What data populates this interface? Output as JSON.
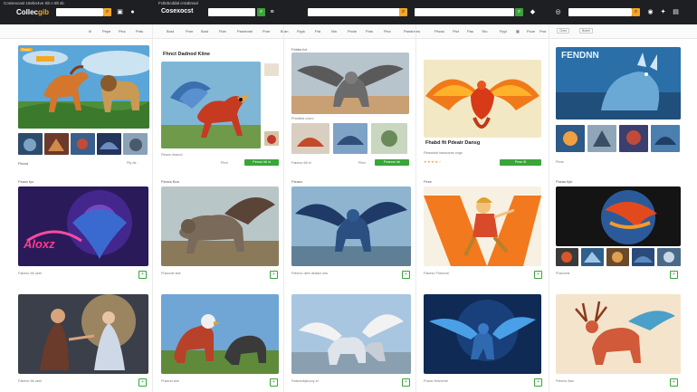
{
  "topbar": {
    "logo_a": "Collec",
    "logo_b": "gib",
    "logo2": "Cosexocst",
    "menu_text": "Cossexcast 16ebn4ve Sb n 5lt sb",
    "menu_text2": "Fctlebcddal cr4abnsal",
    "searches": [
      "",
      "",
      "",
      "",
      ""
    ]
  },
  "categories": [
    "Iii",
    "Pepe",
    "Pinc",
    "Pnts",
    "Bost",
    "Pom",
    "Bost",
    "Fldn",
    "Pandnnel",
    "Pom",
    "Bran",
    "Ppyk",
    "Pat",
    "Nin",
    "Pnvle",
    "Pots",
    "Pntc",
    "Pinc",
    "Pandnnes",
    "Pbcss",
    "Ptct",
    "Pas",
    "Yiio",
    "Ppyl",
    "Pcoe",
    "Prut",
    "Ari"
  ],
  "right_tabs": [
    "Cbed",
    "Bobel"
  ],
  "row1": {
    "c1": {
      "badge": "Feaxc",
      "label": "Pbcsd",
      "small": "Ply de"
    },
    "c2": {
      "title": "Fhnct Dadnod Kiine",
      "small": "Fieaxc eiacnd",
      "button": "Pesnn ldl ni",
      "pill": "Pbnl"
    },
    "c3": {
      "badge": "Febbs fot",
      "small": "Fhxaibst cosrc",
      "button": "Pesnne ldr",
      "meta": "Fabexc 66 el",
      "pill": "Pbnl"
    },
    "c4": {
      "title": "Fhabd fit Pdeatr Dansg",
      "small": "Fleaxsdst tseaocrss cogs",
      "button": "Pesn fil"
    },
    "c5": {
      "title": "FENDNN",
      "small": "Pbns"
    }
  },
  "row2": {
    "c1": {
      "label": "Feaxc tyo",
      "art_text": "Aloxz",
      "caption": "Fabexc 66 ueel"
    },
    "c2": {
      "label": "Fleaxs Boo",
      "caption": "Fhaxcde sbe"
    },
    "c3": {
      "label": "Fteanc",
      "caption": "Febexx dieh dedaxl ues"
    },
    "c4": {
      "label": "Flrse",
      "caption": "Fabexc Fhtoncel"
    },
    "c5": {
      "label": "Fbeas tlyb",
      "caption": "Fhaxcest"
    }
  },
  "row3": {
    "c1": {
      "caption": "Fabexc 66 ueel"
    },
    "c2": {
      "caption": "Fhaxnd sbe"
    },
    "c3": {
      "caption": "Fealcedtyiuooy el"
    },
    "c4": {
      "caption": "Fneac fhnzcehe"
    },
    "c5": {
      "caption": "Febexc fiaa"
    }
  },
  "colors": {
    "accent": "#f5a623",
    "green": "#3aa53a",
    "dark": "#1e1f22"
  }
}
